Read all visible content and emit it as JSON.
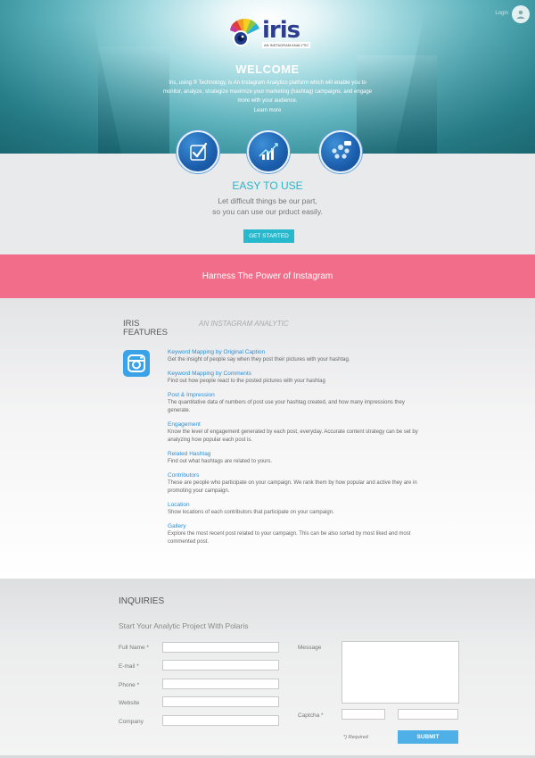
{
  "header": {
    "user_hint": "Login",
    "logo_name": "iris",
    "logo_tagline": "AN INSTAGRAM ANALYTIC",
    "welcome": "WELCOME",
    "intro": "Iris, using ® Technology, is An Instagram Analytics platform which will enable you to monitor, analyze, strategize maximize your marketing (hashtag) campaigns, and engage more with your audience.",
    "learn_more": "Learn more"
  },
  "hero_icons": [
    "checkmark-chart-icon",
    "growth-chart-icon",
    "community-icon"
  ],
  "easy": {
    "title": "EASY TO USE",
    "line1": "Let difficult things be our part,",
    "line2": "so you can use our prduct easily.",
    "button": "GET STARTED"
  },
  "banner": {
    "text": "Harness The Power of Instagram"
  },
  "features": {
    "title_line1": "IRIS",
    "title_line2": "FEATURES",
    "subtitle": "AN INSTAGRAM ANALYTIC",
    "items": [
      {
        "title": "Keyword Mapping by Original Caption",
        "desc": "Get the insight of people say when they post their pictures with your hashtag."
      },
      {
        "title": "Keyword Mapping by Comments",
        "desc": "Find out how people react to the posted pictures with your hashtag"
      },
      {
        "title": "Post & Impression",
        "desc": "The quantitative data of numbers of post use your hashtag created, and how many impressions they generate."
      },
      {
        "title": "Engagement",
        "desc": "Know the level of engagement generated by each post, everyday. Accurate content strategy can be set by analyzing how popular each post is."
      },
      {
        "title": "Related Hashtag",
        "desc": "Find out what hashtags are related to yours."
      },
      {
        "title": "Contributors",
        "desc": "These are people who participate on your campaign. We rank them by how popular and active they are in promoting your campaign."
      },
      {
        "title": "Location",
        "desc": "Show locations of each contributors that participate on your campaign."
      },
      {
        "title": "Gallery",
        "desc": "Explore the most recent post related to your campaign. This can be also sorted by most liked and most commented post."
      }
    ]
  },
  "inquiries": {
    "title": "INQUIRIES",
    "subtitle": "Start Your Analytic Project With Polaris",
    "labels": {
      "full_name": "Full Name *",
      "email": "E-mail *",
      "phone": "Phone *",
      "website": "Website",
      "company": "Company",
      "message": "Message",
      "captcha": "Captcha *"
    },
    "required_note": "*) Required",
    "submit": "SUBMIT"
  }
}
